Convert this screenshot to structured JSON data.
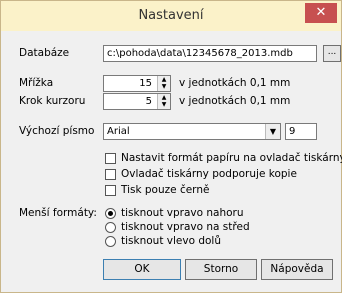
{
  "window": {
    "title": "Nastavení",
    "close_glyph": "✕"
  },
  "form": {
    "database_label": "Databáze",
    "database_value": "c:\\pohoda\\data\\12345678_2013.mdb",
    "browse_label": "...",
    "grid_label": "Mřížka",
    "grid_value": "15",
    "grid_unit": "v jednotkách 0,1 mm",
    "cursor_label": "Krok kurzoru",
    "cursor_value": "5",
    "cursor_unit": "v jednotkách 0,1 mm",
    "font_label": "Výchozí písmo",
    "font_value": "Arial",
    "font_size": "9",
    "checkboxes": [
      {
        "label": "Nastavit formát papíru na ovladač tiskárny",
        "checked": false
      },
      {
        "label": "Ovladač tiskárny podporuje kopie",
        "checked": false
      },
      {
        "label": "Tisk pouze černě",
        "checked": false
      }
    ],
    "small_formats_label": "Menší formáty:",
    "radios": [
      {
        "label": "tisknout vpravo nahoru",
        "checked": true
      },
      {
        "label": "tisknout vpravo na střed",
        "checked": false
      },
      {
        "label": "tisknout vlevo dolů",
        "checked": false
      }
    ]
  },
  "buttons": {
    "ok": "OK",
    "cancel": "Storno",
    "help": "Nápověda"
  }
}
